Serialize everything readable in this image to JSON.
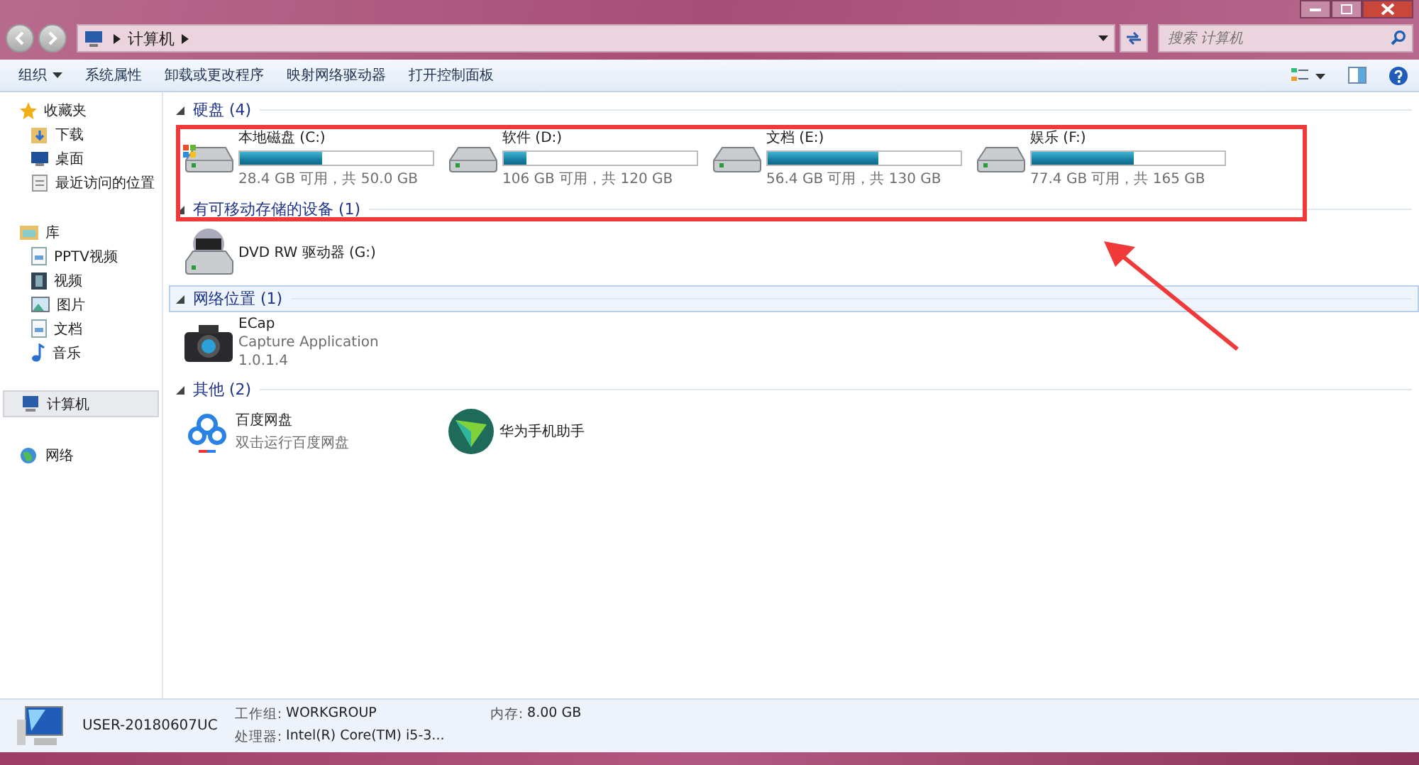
{
  "address_bar": {
    "path": [
      "计算机"
    ]
  },
  "search": {
    "placeholder": "搜索 计算机"
  },
  "toolbar": {
    "buttons": [
      {
        "label": "组织",
        "dropdown": true
      },
      {
        "label": "系统属性",
        "dropdown": false
      },
      {
        "label": "卸载或更改程序",
        "dropdown": false
      },
      {
        "label": "映射网络驱动器",
        "dropdown": false
      },
      {
        "label": "打开控制面板",
        "dropdown": false
      }
    ]
  },
  "sidebar": {
    "groups": [
      {
        "label": "收藏夹",
        "selected": false,
        "children": [
          {
            "label": "下载"
          },
          {
            "label": "桌面"
          },
          {
            "label": "最近访问的位置"
          }
        ]
      },
      {
        "label": "库",
        "selected": false,
        "children": [
          {
            "label": "PPTV视频"
          },
          {
            "label": "视频"
          },
          {
            "label": "图片"
          },
          {
            "label": "文档"
          },
          {
            "label": "音乐"
          }
        ]
      },
      {
        "label": "计算机",
        "selected": true
      },
      {
        "label": "网络",
        "selected": false
      }
    ]
  },
  "sections": [
    {
      "title": "硬盘 (4)",
      "selected": false,
      "items": [
        {
          "kind": "drive",
          "name": "本地磁盘 (C:)",
          "level": 0.43,
          "detail": "28.4 GB 可用，共 50.0 GB",
          "system": true
        },
        {
          "kind": "drive",
          "name": "软件 (D:)",
          "level": 0.12,
          "detail": "106 GB 可用，共 120 GB",
          "system": false
        },
        {
          "kind": "drive",
          "name": "文档 (E:)",
          "level": 0.57,
          "detail": "56.4 GB 可用，共 130 GB",
          "system": false
        },
        {
          "kind": "drive",
          "name": "娱乐 (F:)",
          "level": 0.53,
          "detail": "77.4 GB 可用，共 165 GB",
          "system": false
        }
      ]
    },
    {
      "title": "有可移动存储的设备 (1)",
      "selected": false,
      "items": [
        {
          "kind": "dvd",
          "name": "DVD RW 驱动器 (G:)"
        }
      ]
    },
    {
      "title": "网络位置 (1)",
      "selected": true,
      "items": [
        {
          "kind": "camera",
          "name": "ECap",
          "lines": [
            "Capture Application",
            "1.0.1.4"
          ]
        }
      ]
    },
    {
      "title": "其他 (2)",
      "selected": false,
      "items": [
        {
          "kind": "cloud",
          "name": "百度网盘",
          "lines": [
            "双击运行百度网盘"
          ]
        },
        {
          "kind": "phone",
          "name": "华为手机助手"
        }
      ]
    }
  ],
  "status": {
    "computer": "USER-20180607UC",
    "rows": [
      {
        "label": "工作组:",
        "value": "WORKGROUP"
      },
      {
        "label": "内存:",
        "value": "8.00 GB"
      },
      {
        "label": "处理器:",
        "value": "Intel(R) Core(TM) i5-3..."
      }
    ]
  }
}
